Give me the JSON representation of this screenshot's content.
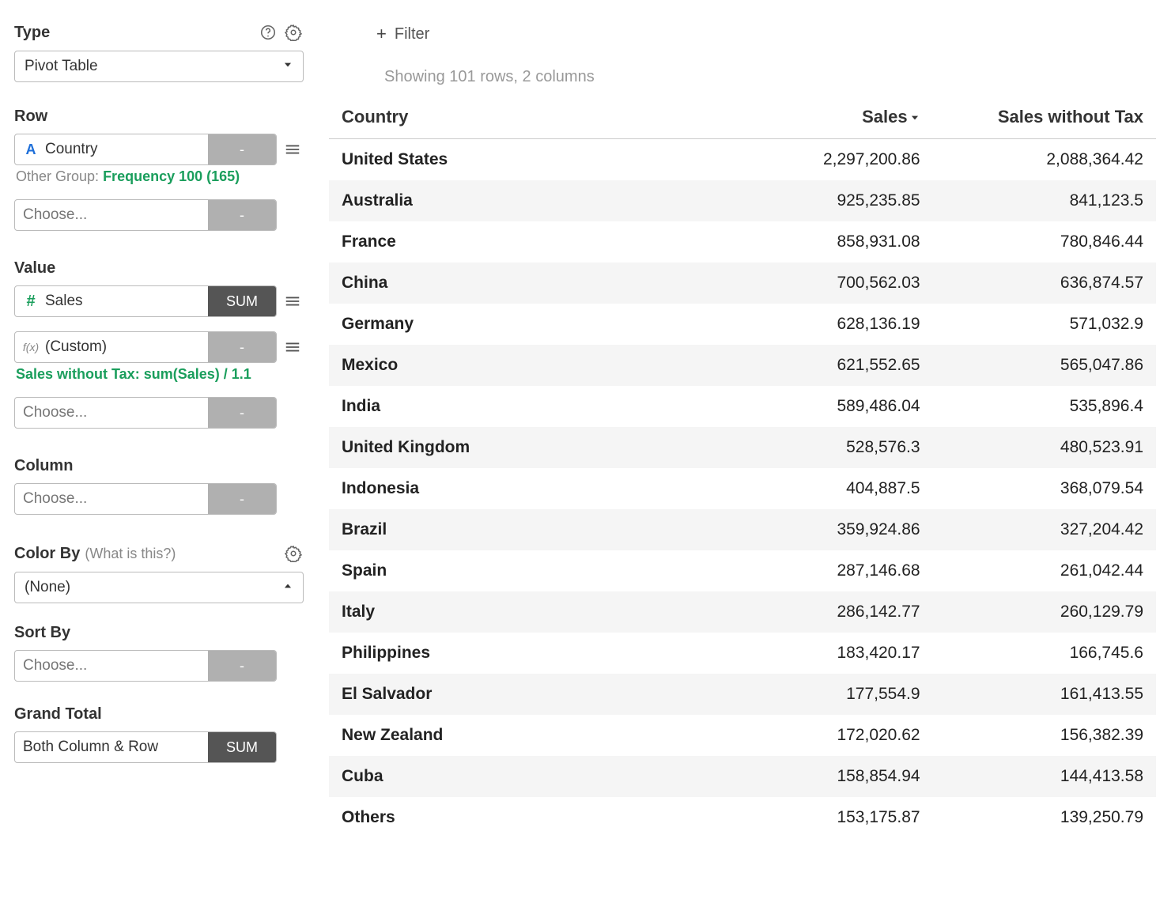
{
  "sidebar": {
    "type_label": "Type",
    "type_value": "Pivot Table",
    "row_label": "Row",
    "row_field": "Country",
    "row_tag": "-",
    "other_group_prefix": "Other Group: ",
    "other_group_value": "Frequency 100 (165)",
    "choose_placeholder": "Choose...",
    "choose_tag": "-",
    "value_label": "Value",
    "value_field": "Sales",
    "value_tag": "SUM",
    "custom_field": "(Custom)",
    "custom_tag": "-",
    "custom_formula": "Sales without Tax: sum(Sales) / 1.1",
    "column_label": "Column",
    "colorby_label": "Color By",
    "colorby_hint": "(What is this?)",
    "colorby_value": "(None)",
    "sortby_label": "Sort By",
    "grandtotal_label": "Grand Total",
    "grandtotal_value": "Both Column & Row",
    "grandtotal_tag": "SUM"
  },
  "main": {
    "filter_label": "Filter",
    "showing": "Showing 101 rows, 2 columns",
    "columns": {
      "country": "Country",
      "sales": "Sales",
      "sales_no_tax": "Sales without Tax"
    },
    "sort_column": "sales",
    "sort_dir": "desc",
    "rows": [
      {
        "country": "United States",
        "sales": "2,297,200.86",
        "sales_no_tax": "2,088,364.42"
      },
      {
        "country": "Australia",
        "sales": "925,235.85",
        "sales_no_tax": "841,123.5"
      },
      {
        "country": "France",
        "sales": "858,931.08",
        "sales_no_tax": "780,846.44"
      },
      {
        "country": "China",
        "sales": "700,562.03",
        "sales_no_tax": "636,874.57"
      },
      {
        "country": "Germany",
        "sales": "628,136.19",
        "sales_no_tax": "571,032.9"
      },
      {
        "country": "Mexico",
        "sales": "621,552.65",
        "sales_no_tax": "565,047.86"
      },
      {
        "country": "India",
        "sales": "589,486.04",
        "sales_no_tax": "535,896.4"
      },
      {
        "country": "United Kingdom",
        "sales": "528,576.3",
        "sales_no_tax": "480,523.91"
      },
      {
        "country": "Indonesia",
        "sales": "404,887.5",
        "sales_no_tax": "368,079.54"
      },
      {
        "country": "Brazil",
        "sales": "359,924.86",
        "sales_no_tax": "327,204.42"
      },
      {
        "country": "Spain",
        "sales": "287,146.68",
        "sales_no_tax": "261,042.44"
      },
      {
        "country": "Italy",
        "sales": "286,142.77",
        "sales_no_tax": "260,129.79"
      },
      {
        "country": "Philippines",
        "sales": "183,420.17",
        "sales_no_tax": "166,745.6"
      },
      {
        "country": "El Salvador",
        "sales": "177,554.9",
        "sales_no_tax": "161,413.55"
      },
      {
        "country": "New Zealand",
        "sales": "172,020.62",
        "sales_no_tax": "156,382.39"
      },
      {
        "country": "Cuba",
        "sales": "158,854.94",
        "sales_no_tax": "144,413.58"
      },
      {
        "country": "Others",
        "sales": "153,175.87",
        "sales_no_tax": "139,250.79"
      }
    ]
  }
}
